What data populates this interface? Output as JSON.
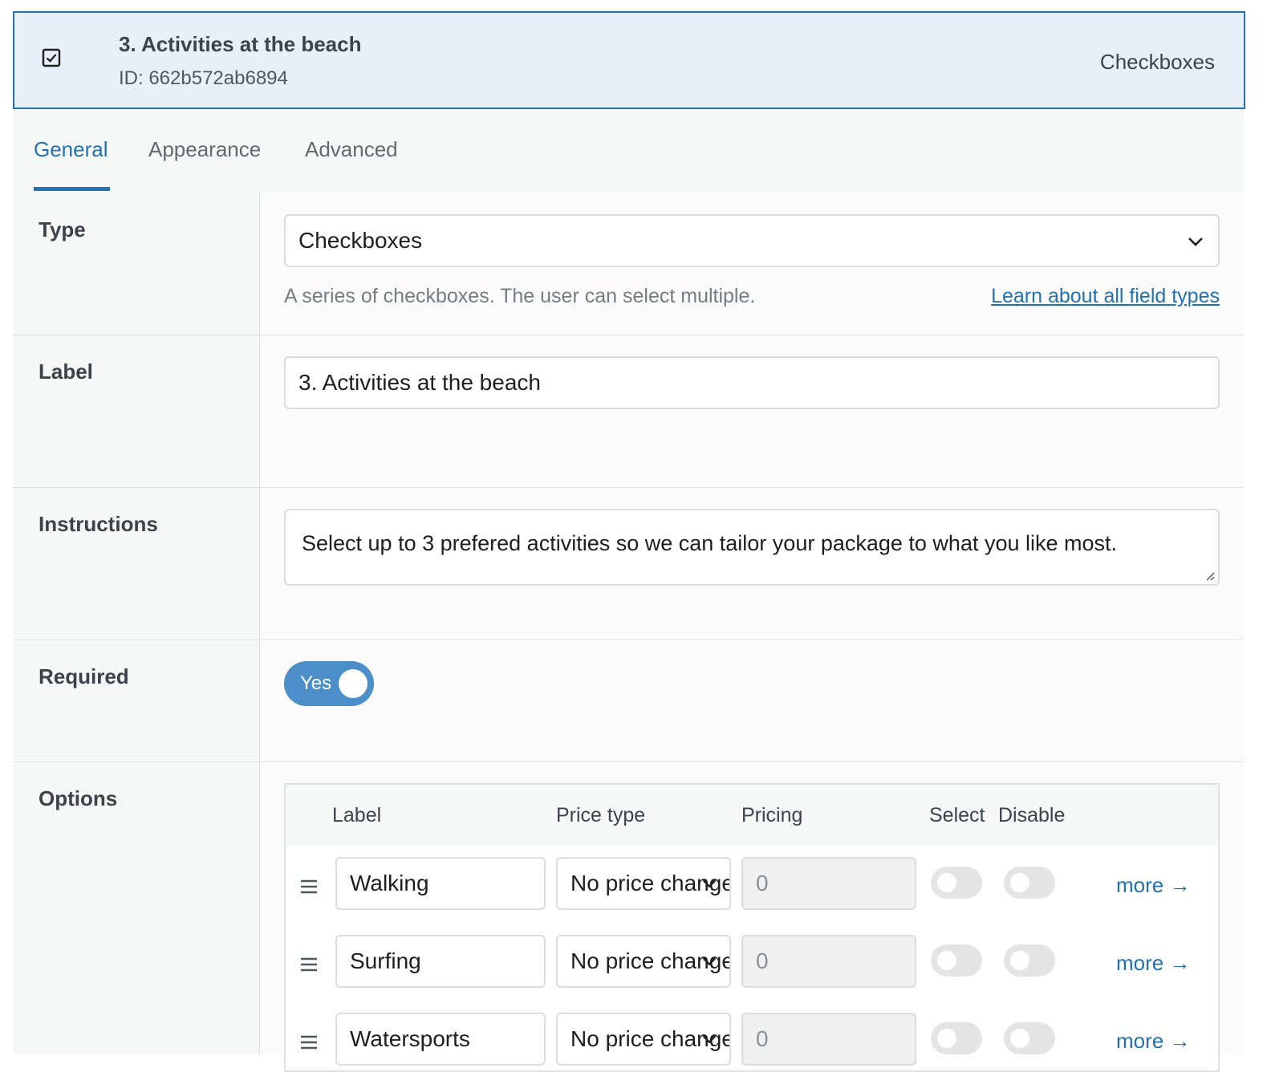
{
  "header": {
    "icon": "checkbox-checked-icon",
    "title": "3. Activities at the beach",
    "id_text": "ID: 662b572ab6894",
    "type_label": "Checkboxes"
  },
  "tabs": [
    {
      "label": "General",
      "active": true
    },
    {
      "label": "Appearance",
      "active": false
    },
    {
      "label": "Advanced",
      "active": false
    }
  ],
  "type_row": {
    "label": "Type",
    "selected": "Checkboxes",
    "hint": "A series of checkboxes. The user can select multiple.",
    "link": "Learn about all field types"
  },
  "label_row": {
    "label": "Label",
    "value": "3. Activities at the beach"
  },
  "instructions_row": {
    "label": "Instructions",
    "value": "Select up to 3 prefered activities so we can tailor your package to what you like most."
  },
  "required_row": {
    "label": "Required",
    "toggle_text": "Yes",
    "on": true
  },
  "options_row": {
    "label": "Options",
    "columns": [
      "Label",
      "Price type",
      "Pricing",
      "Select",
      "Disable"
    ],
    "rows": [
      {
        "label": "Walking",
        "price_type": "No price change",
        "pricing": "0",
        "select": false,
        "disable": false,
        "more": "more →"
      },
      {
        "label": "Surfing",
        "price_type": "No price change",
        "pricing": "0",
        "select": false,
        "disable": false,
        "more": "more →"
      },
      {
        "label": "Watersports",
        "price_type": "No price change",
        "pricing": "0",
        "select": false,
        "disable": false,
        "more": "more →"
      }
    ]
  },
  "colors": {
    "accent": "#2271b1",
    "toggle_on": "#4b8ec9",
    "header_bg": "#e7f0f8"
  }
}
